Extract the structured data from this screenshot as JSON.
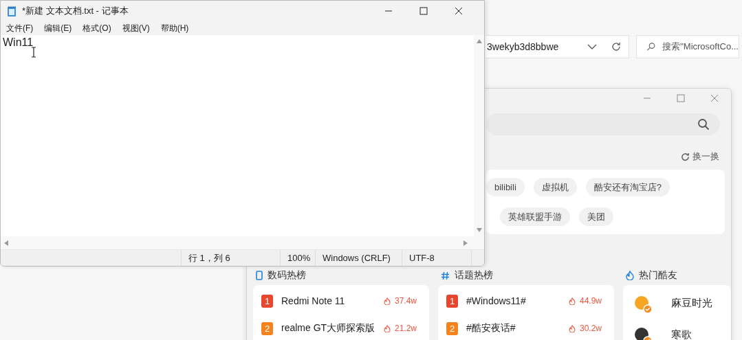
{
  "explorer": {
    "address": "3wekyb3d8bbwe",
    "search": {
      "placeholder": "搜索\"MicrosoftCo..."
    }
  },
  "coolapk": {
    "refresh_label": "换一换",
    "tag_rows": [
      {
        "tags": [
          "bilibili",
          "虚拟机",
          "酷安还有淘宝店?"
        ]
      },
      {
        "tags": [
          "英雄联盟手游",
          "美团"
        ]
      }
    ],
    "sections": [
      {
        "title": "数码热榜",
        "kind": "devices",
        "items": [
          {
            "rank": "1",
            "color": "#e8472f",
            "name": "Redmi Note 11",
            "heat": "37.4w"
          },
          {
            "rank": "2",
            "color": "#f5841f",
            "name": "realme GT大师探索版",
            "heat": "21.2w"
          }
        ]
      },
      {
        "title": "话题热榜",
        "kind": "topics",
        "items": [
          {
            "rank": "1",
            "color": "#e8472f",
            "name": "#Windows11#",
            "heat": "44.9w"
          },
          {
            "rank": "2",
            "color": "#f5841f",
            "name": "#酷安夜话#",
            "heat": "30.2w"
          }
        ]
      },
      {
        "title": "热门酷友",
        "kind": "users",
        "items": [
          {
            "name": "麻豆时光"
          },
          {
            "name": "寒歌"
          }
        ]
      }
    ]
  },
  "notepad": {
    "title": "*新建 文本文档.txt - 记事本",
    "menu": [
      "文件(F)",
      "编辑(E)",
      "格式(O)",
      "视图(V)",
      "帮助(H)"
    ],
    "text": "Win11",
    "status": [
      "行 1，列 6",
      "100%",
      "Windows (CRLF)",
      "UTF-8"
    ]
  }
}
